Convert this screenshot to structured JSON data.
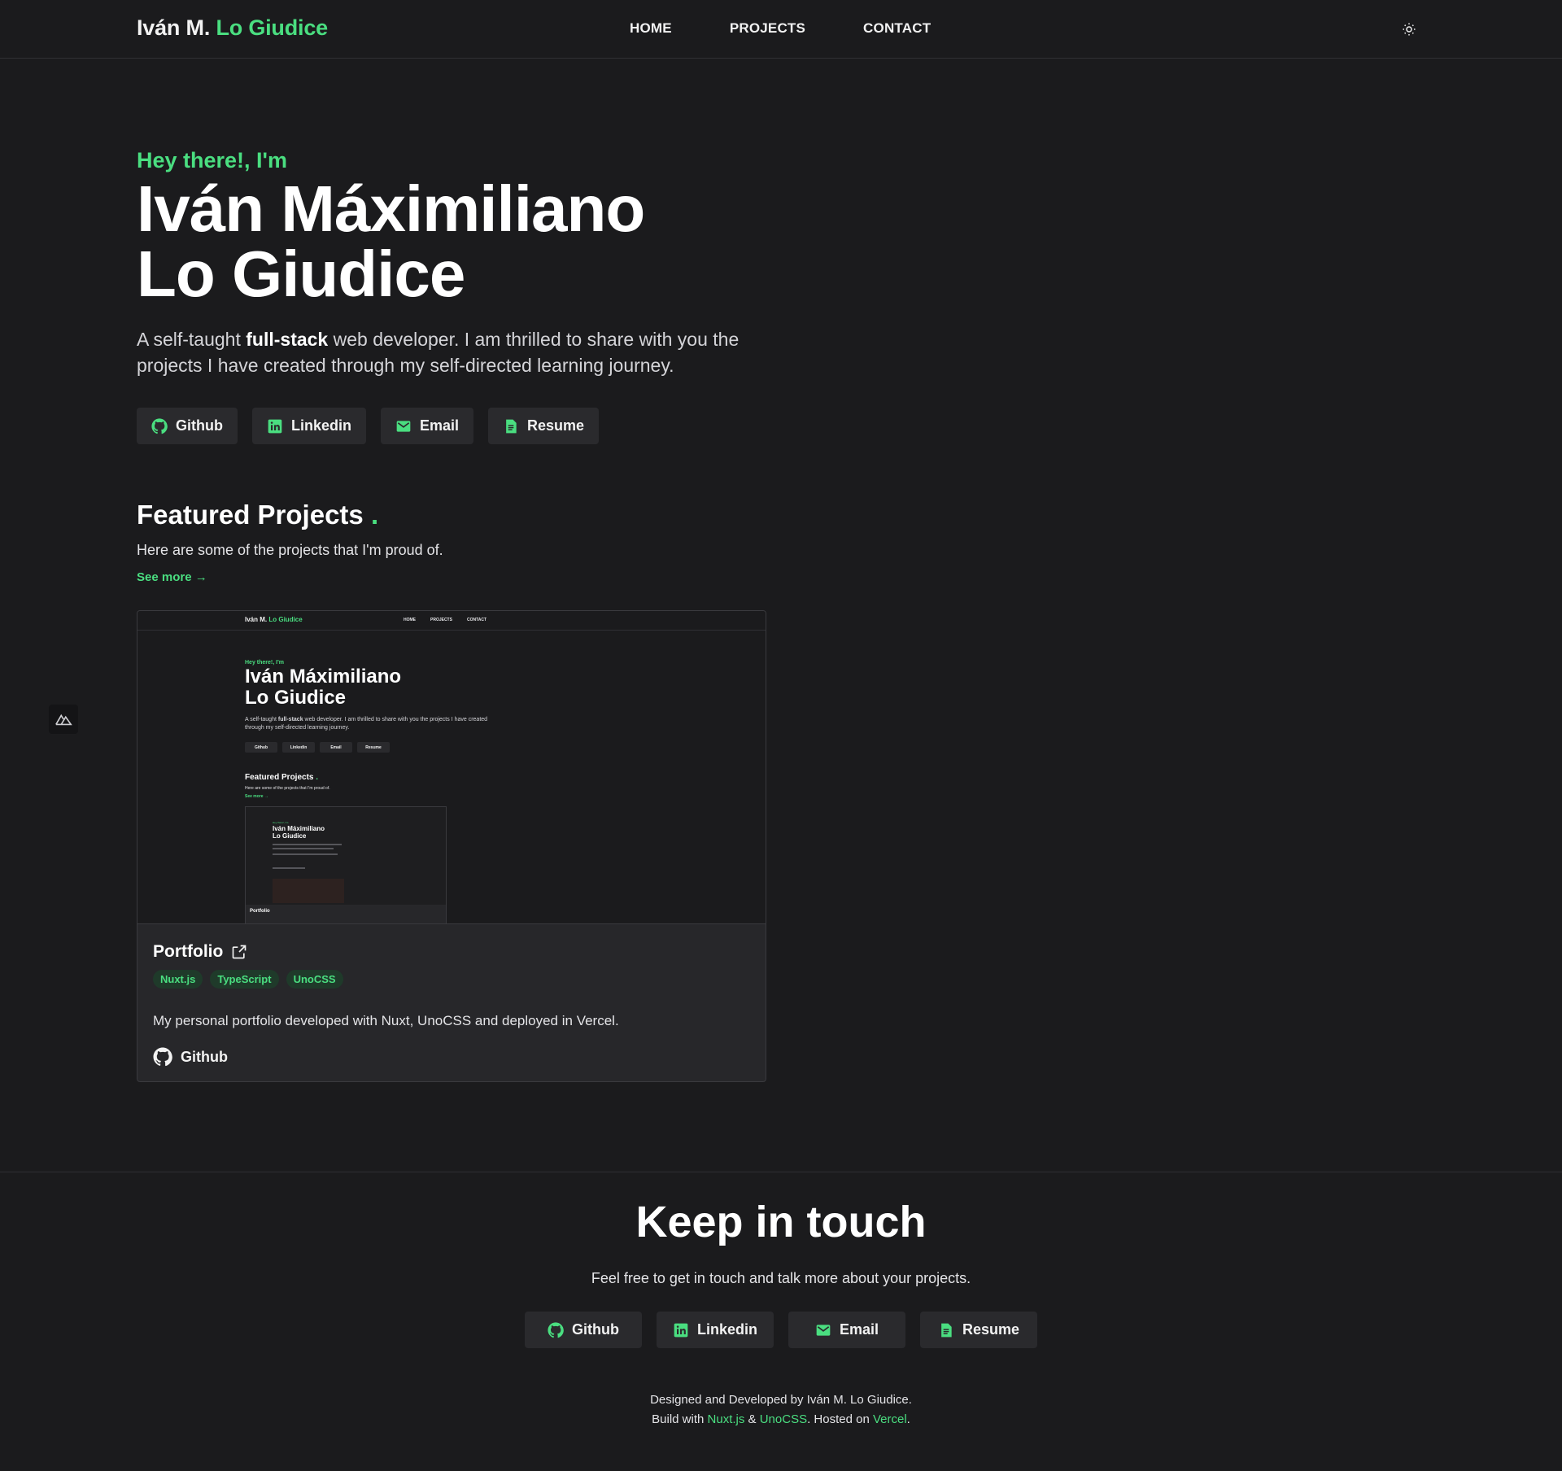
{
  "colors": {
    "background": "#1b1b1d",
    "accent": "#4ade80",
    "card": "#27272a",
    "button": "#2a2a2d"
  },
  "nav": {
    "brand_first": "Iván M.",
    "brand_last": "Lo Giudice",
    "links": [
      "HOME",
      "PROJECTS",
      "CONTACT"
    ],
    "theme_icon": "sun-icon"
  },
  "hero": {
    "greeting": "Hey there!, I'm",
    "name_line1": "Iván Máximiliano",
    "name_line2": "Lo Giudice",
    "desc_before": "A self-taught ",
    "desc_strong": "full-stack",
    "desc_after": " web developer. I am thrilled to share with you the projects I have created through my self-directed learning journey.",
    "buttons": [
      {
        "label": "Github",
        "icon": "github-icon"
      },
      {
        "label": "Linkedin",
        "icon": "linkedin-icon"
      },
      {
        "label": "Email",
        "icon": "email-icon"
      },
      {
        "label": "Resume",
        "icon": "resume-icon"
      }
    ]
  },
  "featured": {
    "title": "Featured Projects",
    "dot": ".",
    "subtitle": "Here are some of the projects that I'm proud of.",
    "see_more": "See more →",
    "project": {
      "title": "Portfolio",
      "tags": [
        "Nuxt.js",
        "TypeScript",
        "UnoCSS"
      ],
      "description": "My personal portfolio developed with Nuxt, UnoCSS and deployed in Vercel.",
      "github_label": "Github"
    }
  },
  "contact": {
    "title": "Keep in touch",
    "subtitle": "Feel free to get in touch and talk more about your projects.",
    "buttons": [
      {
        "label": "Github",
        "icon": "github-icon"
      },
      {
        "label": "Linkedin",
        "icon": "linkedin-icon"
      },
      {
        "label": "Email",
        "icon": "email-icon"
      },
      {
        "label": "Resume",
        "icon": "resume-icon"
      }
    ]
  },
  "credits": {
    "line1": "Designed and Developed by Iván M. Lo Giudice.",
    "build_with": "Build with ",
    "nuxt": "Nuxt.js",
    "amp": " & ",
    "unocss": "UnoCSS",
    "hosted_on": ". Hosted on ",
    "vercel": "Vercel",
    "end": "."
  }
}
